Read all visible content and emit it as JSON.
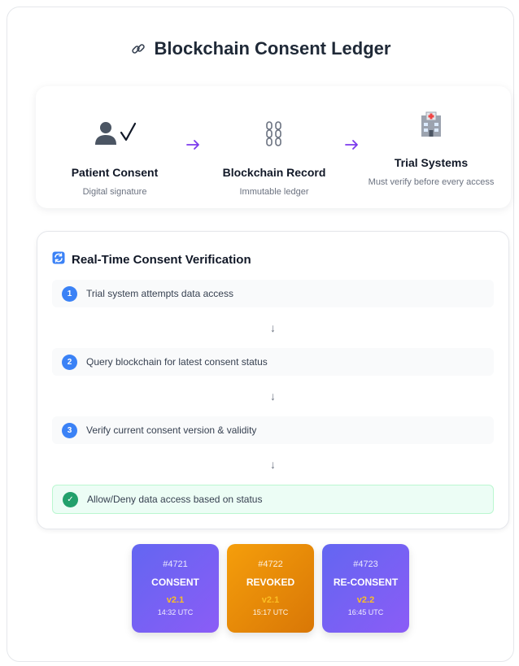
{
  "title": "Blockchain Consent Ledger",
  "flow": [
    {
      "name": "Patient Consent",
      "desc": "Digital signature",
      "icon": "patient-check-icon"
    },
    {
      "name": "Blockchain Record",
      "desc": "Immutable ledger",
      "icon": "chain-icon"
    },
    {
      "name": "Trial Systems",
      "desc": "Must verify before every access",
      "icon": "hospital-icon"
    }
  ],
  "verification": {
    "title": "Real-Time Consent Verification",
    "steps": [
      {
        "num": "1",
        "text": "Trial system attempts data access"
      },
      {
        "num": "2",
        "text": "Query blockchain for latest consent status"
      },
      {
        "num": "3",
        "text": "Verify current consent version & validity"
      },
      {
        "num": "✓",
        "text": "Allow/Deny data access based on status"
      }
    ],
    "arrow": "↓"
  },
  "blocks": [
    {
      "id": "#4721",
      "status": "CONSENT",
      "version": "v2.1",
      "time": "14:32 UTC"
    },
    {
      "id": "#4722",
      "status": "REVOKED",
      "version": "v2.1",
      "time": "15:17 UTC"
    },
    {
      "id": "#4723",
      "status": "RE-CONSENT",
      "version": "v2.2",
      "time": "16:45 UTC"
    }
  ],
  "colors": {
    "accent": "#7c3aed",
    "step": "#3b82f6",
    "ok": "#22a06b",
    "revoked": "#f59e0b",
    "block": "#6366f1"
  }
}
